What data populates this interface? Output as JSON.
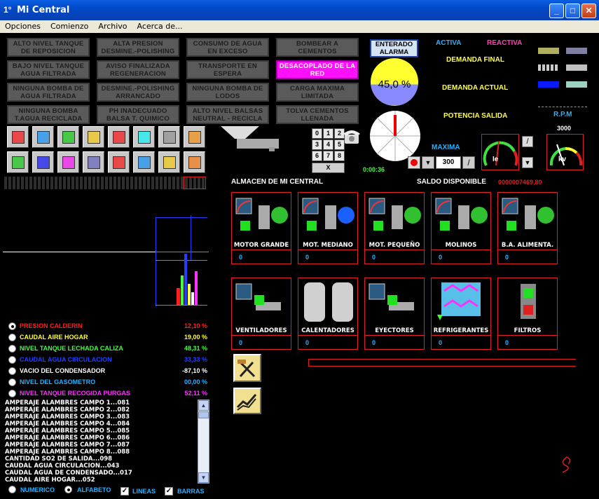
{
  "window": {
    "title": "Mi Central",
    "icon_text": "1°"
  },
  "menu": [
    "Opciones",
    "Comienzo",
    "Archivo",
    "Acerca de..."
  ],
  "alarms": [
    [
      "ALTO NIVEL TANQUE",
      "DE REPOSICION"
    ],
    [
      "ALTA PRESION",
      "DESMINE.-POLISHING"
    ],
    [
      "CONSUMO DE AGUA",
      "EN EXCESO"
    ],
    [
      "BOMBEAR A",
      "CEMENTOS"
    ],
    [
      "BAJO NIVEL TANQUE",
      "AGUA FILTRADA"
    ],
    [
      "AVISO FINALIZADA",
      "REGENERACION"
    ],
    [
      "TRANSPORTE EN",
      "ESPERA"
    ],
    [
      "DESACOPLADO DE LA",
      "RED"
    ],
    [
      "NINGUNA BOMBA DE",
      "AGUA FILTRADA"
    ],
    [
      "DESMINE.-POLISHING",
      "ARRANCADO"
    ],
    [
      "NINGUNA BOMBA DE",
      "LODOS"
    ],
    [
      "CARGA MAXIMA",
      "LIMITADA"
    ],
    [
      "NINGUNA BOMBA",
      "T.AGUA RECICLADA"
    ],
    [
      "PH INADECUADO",
      "BALSA T. QUIMICO"
    ],
    [
      "ALTO NIVEL BALSAS",
      "NEUTRAL - RECICLA"
    ],
    [
      "TOLVA CEMENTOS",
      "LLENADA"
    ]
  ],
  "alarm_active_index": 7,
  "enterado": [
    "ENTERADO",
    "ALARMA"
  ],
  "gauge_percent": "45,0 %",
  "gauge_fill": 0.45,
  "timer": "0:00:36",
  "keypad": [
    "0",
    "1",
    "2",
    "3",
    "4",
    "5",
    "6",
    "7",
    "8",
    "X"
  ],
  "power": {
    "activa": "ACTIVA",
    "reactiva": "REACTIVA",
    "demanda_final": "DEMANDA FINAL",
    "demanda_actual": "DEMANDA ACTUAL",
    "potencia_salida": "POTENCIA SALIDA",
    "rpm": "R.P.M",
    "rpm_max": "3000",
    "maxima": "MAXIMA",
    "maxima_value": "300",
    "gauge1": "Ie",
    "gauge2": "kv"
  },
  "colors": {
    "activa": "#29b0ff",
    "reactiva": "#ff3fb0",
    "label_yellow": "#ffff40",
    "alarm_on": "#ff10ff"
  },
  "almacen": {
    "title": "ALMACEN DE MI CENTRAL",
    "saldo_label": "SALDO DISPONIBLE",
    "saldo_value": "0000007469,80"
  },
  "panels": [
    {
      "name": "MOTOR GRANDE",
      "value": "0"
    },
    {
      "name": "MOT. MEDIANO",
      "value": "0"
    },
    {
      "name": "MOT. PEQUEÑO",
      "value": "0"
    },
    {
      "name": "MOLINOS",
      "value": "0"
    },
    {
      "name": "B.A. ALIMENTA.",
      "value": "0"
    },
    {
      "name": "VENTILADORES",
      "value": "0"
    },
    {
      "name": "CALENTADORES",
      "value": "0"
    },
    {
      "name": "EYECTORES",
      "value": "0"
    },
    {
      "name": "REFRIGERANTES",
      "value": "0"
    },
    {
      "name": "FILTROS",
      "value": "0"
    }
  ],
  "variables": [
    {
      "label": "PRESION CALDERIN",
      "value": "12,10 %",
      "color": "#ff2020",
      "selected": true
    },
    {
      "label": "CAUDAL AIRE HOGAR",
      "value": "19,00 %",
      "color": "#ffff40",
      "selected": false
    },
    {
      "label": "NIVEL TANQUE LECHADA CALIZA",
      "value": "48,31 %",
      "color": "#40ff40",
      "selected": false
    },
    {
      "label": "CAUDAL AGUA CIRCULACION",
      "value": "33,33 %",
      "color": "#2040ff",
      "selected": false
    },
    {
      "label": "VACIO DEL CONDENSADOR",
      "value": "-87,10 %",
      "color": "#ffffff",
      "selected": false
    },
    {
      "label": "NIVEL DEL GASOMETRO",
      "value": "00,00 %",
      "color": "#29b0ff",
      "selected": false
    },
    {
      "label": "NIVEL TANQUE RECOGIDA PURGAS",
      "value": "52,11 %",
      "color": "#ff30ff",
      "selected": false
    }
  ],
  "list_items": [
    "AMPERAJE ALAMBRES CAMPO 1...081",
    "AMPERAJE ALAMBRES CAMPO 2...082",
    "AMPERAJE ALAMBRES CAMPO 3...083",
    "AMPERAJE ALAMBRES CAMPO 4...084",
    "AMPERAJE ALAMBRES CAMPO 5...085",
    "AMPERAJE ALAMBRES CAMPO 6...086",
    "AMPERAJE ALAMBRES CAMPO 7...087",
    "AMPERAJE ALAMBRES CAMPO 8...088",
    "CANTIDAD SO2 DE SALIDA...098",
    "CAUDAL AGUA CIRCULACION...043",
    "CAUDAL AGUA DE CONDENSADO...017",
    "CAUDAL AIRE HOGAR...052"
  ],
  "bottom": {
    "numerico": "NUMERICO",
    "alfabeto": "ALFABETO",
    "lineas": "LINEAS",
    "barras": "BARRAS"
  }
}
